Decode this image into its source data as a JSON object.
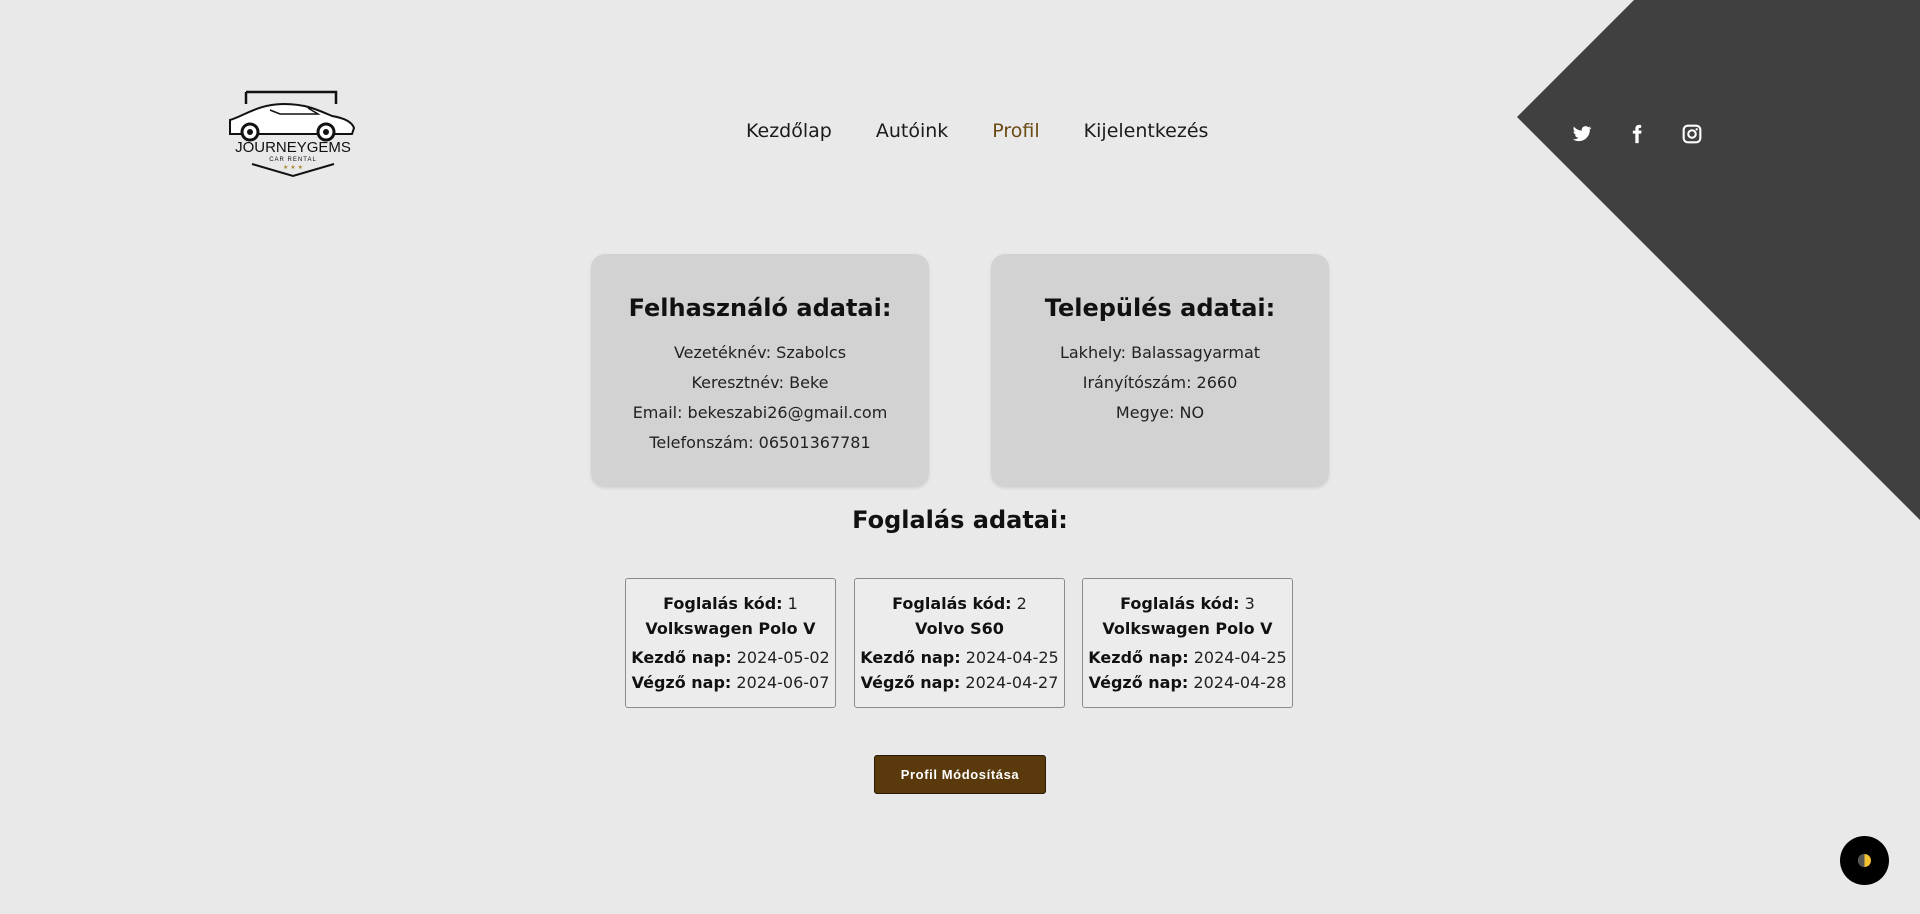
{
  "brand": {
    "name": "JOURNEYGEMS",
    "tagline": "CAR RENTAL"
  },
  "nav": {
    "items": [
      {
        "label": "Kezdőlap"
      },
      {
        "label": "Autóink"
      },
      {
        "label": "Profil",
        "active": true
      },
      {
        "label": "Kijelentkezés"
      }
    ]
  },
  "social": [
    "twitter-icon",
    "facebook-icon",
    "instagram-icon"
  ],
  "user_card": {
    "title": "Felhasználó adatai:",
    "lines": [
      "Vezetéknév: Szabolcs",
      "Keresztnév: Beke",
      "Email: bekeszabi26@gmail.com",
      "Telefonszám: 06501367781"
    ]
  },
  "place_card": {
    "title": "Település adatai:",
    "lines": [
      "Lakhely: Balassagyarmat",
      "Irányítószám: 2660",
      "Megye: NO"
    ]
  },
  "bookings": {
    "title": "Foglalás adatai:",
    "code_label": "Foglalás kód:",
    "start_label": "Kezdő nap:",
    "end_label": "Végző nap:",
    "items": [
      {
        "code": "1",
        "car": "Volkswagen Polo V",
        "start": "2024-05-02",
        "end": "2024-06-07"
      },
      {
        "code": "2",
        "car": "Volvo S60",
        "start": "2024-04-25",
        "end": "2024-04-27"
      },
      {
        "code": "3",
        "car": "Volkswagen Polo V",
        "start": "2024-04-25",
        "end": "2024-04-28"
      }
    ]
  },
  "edit_button": {
    "label": "Profil Módosítása"
  },
  "colors": {
    "background": "#e9e9e9",
    "corner": "#404040",
    "card": "#d2d2d2",
    "accent": "#5a3a0c",
    "nav_active": "#6b4a14"
  }
}
